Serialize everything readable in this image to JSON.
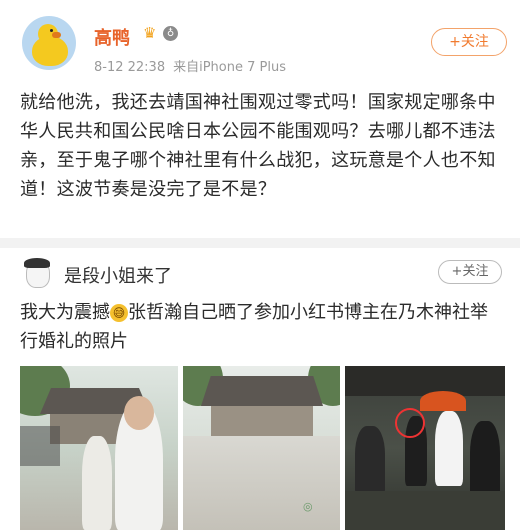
{
  "post1": {
    "username": "高鸭",
    "crown_glyph": "♛",
    "badge_glyph": "♁",
    "time": "8-12 22:38",
    "source": "来自iPhone 7 Plus",
    "follow_label": "+关注",
    "text": "就给他洗，我还去靖国神社围观过零式吗！国家规定哪条中华人民共和国公民啥日本公园不能围观吗？去哪儿都不违法亲，至于鬼子哪个神社里有什么战犯，这玩意是个人也不知道！这波节奏是没完了是不是？"
  },
  "post2": {
    "username": "是段小姐来了",
    "follow_label": "+关注",
    "text_before_emoji": "我大为震撼",
    "emoji_glyph": "😅",
    "text_after_emoji": "张哲瀚自己晒了参加小红书博主在乃木神社举行婚礼的照片"
  },
  "colors": {
    "brand_orange": "#f17b2f",
    "username_orange": "#e8632a"
  },
  "icons": [
    "duck-avatar-icon",
    "crown-icon",
    "badge-icon",
    "avatar-icon",
    "emoji-icon"
  ]
}
